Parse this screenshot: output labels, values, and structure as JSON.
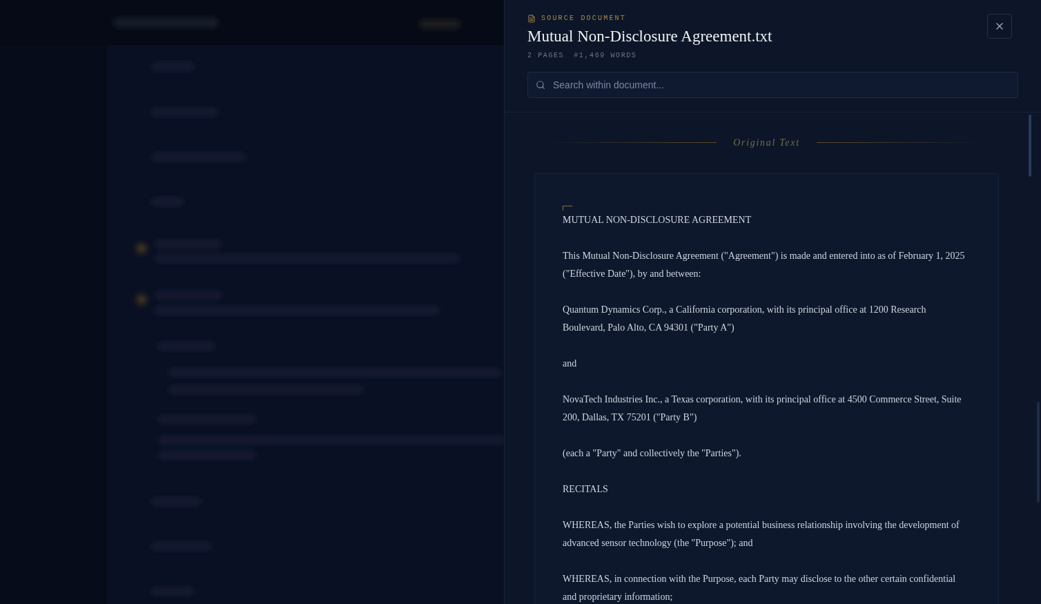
{
  "panel": {
    "eyebrow": "SOURCE DOCUMENT",
    "title": "Mutual Non-Disclosure Agreement.txt",
    "meta": [
      {
        "kind": "pages",
        "text": "2 PAGES"
      },
      {
        "kind": "words",
        "icon": "#",
        "text": "1,469 WORDS"
      }
    ],
    "search": {
      "placeholder": "Search within document..."
    }
  },
  "section_label": "Original Text",
  "document": {
    "paragraphs": [
      "MUTUAL NON-DISCLOSURE AGREEMENT",
      "This Mutual Non-Disclosure Agreement (\"Agreement\") is made and entered into as of February 1, 2025 (\"Effective Date\"), by and between:",
      "Quantum Dynamics Corp., a California corporation, with its principal office at 1200 Research Boulevard, Palo Alto, CA 94301 (\"Party A\")",
      "and",
      "NovaTech Industries Inc., a Texas corporation, with its principal office at 4500 Commerce Street, Suite 200, Dallas, TX 75201 (\"Party B\")",
      "(each a \"Party\" and collectively the \"Parties\").",
      "RECITALS",
      "WHEREAS, the Parties wish to explore a potential business relationship involving the development of advanced sensor technology (the \"Purpose\"); and",
      "WHEREAS, in connection with the Purpose, each Party may disclose to the other certain confidential and proprietary information;"
    ]
  }
}
